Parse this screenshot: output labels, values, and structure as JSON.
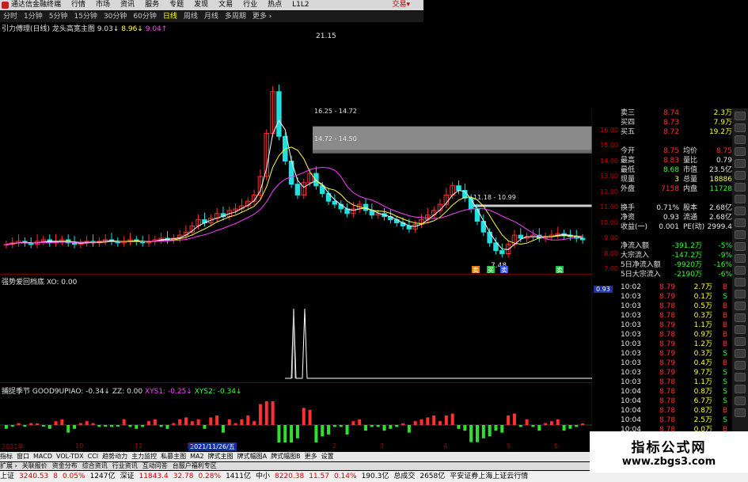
{
  "titlebar": {
    "items": [
      "通达信金融终端",
      "行情",
      "市场",
      "资讯",
      "服务",
      "专题",
      "发现",
      "文易",
      "行业",
      "热点",
      "L1L2"
    ],
    "trade": "交易▾"
  },
  "periodbar": {
    "items": [
      "分时",
      "1分钟",
      "5分钟",
      "15分钟",
      "30分钟",
      "60分钟",
      "日线",
      "周线",
      "月线",
      "多周期",
      "更多 ›"
    ],
    "active": "日线"
  },
  "main_indicator": {
    "name": "引力傅理(日线)",
    "sub": "龙头高宽主图",
    "v1": "9.03↓",
    "v2": "8.96↓",
    "v3": "9.04↑"
  },
  "price_annotations": {
    "high": "21.15",
    "low": "7.48",
    "band1": "16.25 - 14.72",
    "band2": "14.72 - 14.50",
    "band3": "11.18 - 10.99"
  },
  "price_scale": [
    "16.00",
    "15.00",
    "14.00",
    "13.00",
    "12.00",
    "11.00",
    "10.00",
    "9.00",
    "8.00",
    "7.00"
  ],
  "signal_tags": [
    "卖",
    "买",
    "卖",
    "卖"
  ],
  "ind1": {
    "label": "强势爱回档底  XO: 0.00",
    "value": "0.93"
  },
  "ind2": {
    "name": "捕捉季节  GOOD9UPIAO: -0.34↓",
    "zz": "ZZ: 0.00",
    "xys1": "XYS1: -0.25↓",
    "xys2": "XYS2: -0.34↓",
    "scale": [
      "5.00",
      "0.00"
    ]
  },
  "date_axis": {
    "labels": [
      "2021年",
      "10",
      "11",
      "12",
      "2",
      "3",
      "4",
      "5",
      "6"
    ],
    "current": "2021/11/26/五"
  },
  "tabs": [
    "指标",
    "窗口",
    "MACD",
    "VOL-TDX",
    "CCI",
    "趋势动力",
    "主力监控",
    "私募主图",
    "MA2",
    "牌式主图",
    "牌式幅图A",
    "牌式幅图B",
    "更多",
    "设置"
  ],
  "subbar": [
    "扩展 ›",
    "关联报价",
    "资金分布",
    "综合资讯",
    "行业资讯",
    "互动问答",
    "台服户福利专区"
  ],
  "statusbar": [
    {
      "t": "上证",
      "c": ""
    },
    {
      "t": "3240.53",
      "c": "r"
    },
    {
      "t": "8",
      "c": "r"
    },
    {
      "t": "0.05%",
      "c": "r"
    },
    {
      "t": "1247亿",
      "c": ""
    },
    {
      "t": "深证",
      "c": ""
    },
    {
      "t": "11843.4",
      "c": "r"
    },
    {
      "t": "32.78",
      "c": "r"
    },
    {
      "t": "0.28%",
      "c": "r"
    },
    {
      "t": "1411亿",
      "c": ""
    },
    {
      "t": "中小",
      "c": ""
    },
    {
      "t": "8220.38",
      "c": "r"
    },
    {
      "t": "11.57",
      "c": "r"
    },
    {
      "t": "0.14%",
      "c": "r"
    },
    {
      "t": "190.3亿",
      "c": ""
    },
    {
      "t": "总成交",
      "c": ""
    },
    {
      "t": "2658亿",
      "c": ""
    },
    {
      "t": "平安证券上海上证云行情",
      "c": ""
    }
  ],
  "quote": {
    "rows": [
      {
        "l": "卖三",
        "v": "8.74",
        "vc": "red",
        "l2": "",
        "v2": "2.3万",
        "v2c": "yel"
      },
      {
        "l": "买四",
        "v": "8.73",
        "vc": "red",
        "l2": "",
        "v2": "7.9万",
        "v2c": "yel"
      },
      {
        "l": "买五",
        "v": "8.72",
        "vc": "red",
        "l2": "",
        "v2": "19.2万",
        "v2c": "yel"
      },
      {
        "l": "",
        "v": "",
        "vc": "",
        "l2": "",
        "v2": "",
        "v2c": ""
      },
      {
        "l": "今开",
        "v": "8.75",
        "vc": "red",
        "l2": "均价",
        "v2": "8.75",
        "v2c": "red"
      },
      {
        "l": "最高",
        "v": "8.83",
        "vc": "red",
        "l2": "量比",
        "v2": "0.79",
        "v2c": "wht"
      },
      {
        "l": "最低",
        "v": "8.68",
        "vc": "grn",
        "l2": "市值",
        "v2": "23.5亿",
        "v2c": "wht"
      },
      {
        "l": "现量",
        "v": "3",
        "vc": "yel",
        "l2": "总量",
        "v2": "18886",
        "v2c": "yel"
      },
      {
        "l": "外盘",
        "v": "7158",
        "vc": "red",
        "l2": "内盘",
        "v2": "11728",
        "v2c": "grn"
      },
      {
        "l": "",
        "v": "",
        "vc": "",
        "l2": "",
        "v2": "",
        "v2c": ""
      },
      {
        "l": "换手",
        "v": "0.71%",
        "vc": "wht",
        "l2": "股本",
        "v2": "2.68亿",
        "v2c": "wht"
      },
      {
        "l": "净资",
        "v": "0.93",
        "vc": "wht",
        "l2": "流通",
        "v2": "2.68亿",
        "v2c": "wht"
      },
      {
        "l": "收益(一)",
        "v": "0.001",
        "vc": "wht",
        "l2": "PE(动)",
        "v2": "2999.4",
        "v2c": "wht"
      }
    ],
    "flow": [
      {
        "l": "净流入额",
        "v": "-391.2万",
        "v2": "-5%"
      },
      {
        "l": "大宗流入",
        "v": "-147.2万",
        "v2": "-9%"
      },
      {
        "l": "5日净流入额",
        "v": "-9920万",
        "v2": "-16%"
      },
      {
        "l": "5日大宗流入",
        "v": "-2190万",
        "v2": "-6%"
      }
    ]
  },
  "ticks": [
    [
      "10:02",
      "8.79",
      "2.7万",
      "B"
    ],
    [
      "10:03",
      "8.79",
      "0.1万",
      "S"
    ],
    [
      "10:03",
      "8.78",
      "0.5万",
      "B"
    ],
    [
      "10:03",
      "8.78",
      "0.3万",
      "B"
    ],
    [
      "10:03",
      "8.79",
      "1.1万",
      "B"
    ],
    [
      "10:03",
      "8.78",
      "0.9万",
      "B"
    ],
    [
      "10:03",
      "8.79",
      "1.2万",
      "B"
    ],
    [
      "10:03",
      "8.79",
      "0.3万",
      "S"
    ],
    [
      "10:03",
      "8.79",
      "0.4万",
      "B"
    ],
    [
      "10:03",
      "8.79",
      "9.7万",
      "S"
    ],
    [
      "10:03",
      "8.78",
      "1.1万",
      "S"
    ],
    [
      "10:04",
      "8.78",
      "0.8万",
      "S"
    ],
    [
      "10:04",
      "8.78",
      "6.7万",
      "S"
    ],
    [
      "10:04",
      "8.78",
      "0.8万",
      "B"
    ],
    [
      "10:04",
      "8.78",
      "2.5万",
      "S"
    ],
    [
      "10:04",
      "8.78",
      "0.0万",
      "B"
    ]
  ],
  "watermark": {
    "t1": "指标公式网",
    "t2": "www.zbgs3.com"
  },
  "chart_data": [
    {
      "type": "candlestick",
      "title": "引力傅理(日线)",
      "price_range": [
        7,
        17
      ],
      "series": [
        {
          "name": "close",
          "values": [
            8.6,
            8.7,
            8.8,
            8.7,
            8.6,
            8.8,
            8.9,
            8.7,
            8.8,
            8.9,
            8.7,
            8.6,
            8.7,
            8.8,
            8.7,
            8.8,
            8.9,
            8.8,
            8.7,
            8.8,
            8.9,
            8.8,
            8.7,
            8.8,
            8.9,
            9.0,
            8.9,
            9.0,
            9.2,
            9.4,
            9.8,
            10.2,
            10.0,
            10.3,
            10.6,
            10.4,
            10.8,
            10.9,
            11.1,
            11.4,
            11.8,
            13.0,
            15.8,
            18.5,
            15.6,
            14.0,
            12.5,
            11.8,
            12.6,
            13.2,
            12.4,
            11.9,
            11.4,
            11.2,
            10.9,
            10.6,
            10.9,
            11.2,
            10.8,
            10.5,
            10.6,
            10.4,
            10.2,
            10.0,
            9.8,
            9.6,
            9.9,
            10.2,
            10.5,
            10.8,
            11.2,
            11.8,
            12.4,
            12.1,
            11.6,
            10.9,
            10.1,
            9.4,
            8.7,
            8.2,
            8.0,
            8.6,
            9.2,
            9.0,
            9.1,
            9.2,
            9.0,
            9.1,
            9.2,
            9.3,
            9.2,
            9.1,
            9.0,
            8.9
          ]
        }
      ]
    },
    {
      "type": "line",
      "title": "强势爱回档底",
      "values": [
        0,
        0,
        1,
        0,
        1,
        0,
        0
      ],
      "ylim": [
        0,
        1
      ]
    },
    {
      "type": "bar",
      "title": "捕捉季节",
      "ylim": [
        -5,
        5
      ]
    }
  ]
}
